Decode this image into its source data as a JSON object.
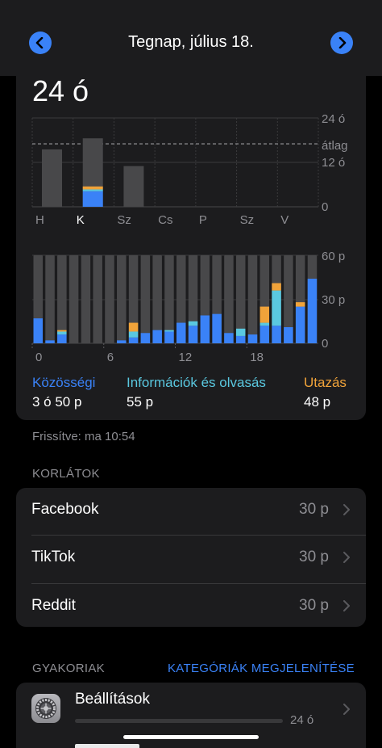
{
  "header": {
    "title": "Tegnap, július 18."
  },
  "summary": {
    "total": "24 ó"
  },
  "weekly_chart": {
    "days": [
      "H",
      "K",
      "Sz",
      "Cs",
      "P",
      "Sz",
      "V"
    ],
    "axis": {
      "top": "24 ó",
      "avg": "átlag",
      "mid": "12 ó",
      "zero": "0"
    },
    "colors": {
      "social": "#3a82f7",
      "info": "#5ac8e0",
      "travel": "#f0a33a",
      "other": "#48484a"
    }
  },
  "chart_data": [
    {
      "type": "bar",
      "categories": [
        "H",
        "K",
        "Sz",
        "Cs",
        "P",
        "Sz",
        "V"
      ],
      "series": [
        {
          "name": "Közösségi",
          "values": [
            0,
            4.2,
            0,
            0,
            0,
            0,
            0
          ]
        },
        {
          "name": "Információk és olvasás",
          "values": [
            0,
            0.5,
            0,
            0,
            0,
            0,
            0
          ]
        },
        {
          "name": "Utazás",
          "values": [
            0,
            0.8,
            0,
            0,
            0,
            0,
            0
          ]
        },
        {
          "values": [
            15.5,
            18.5,
            11,
            0,
            0,
            0,
            0
          ]
        }
      ],
      "ylim": [
        0,
        24
      ],
      "average": 17
    },
    {
      "type": "bar",
      "categories": [
        "0",
        "1",
        "2",
        "3",
        "4",
        "5",
        "6",
        "7",
        "8",
        "9",
        "10",
        "11",
        "12",
        "13",
        "14",
        "15",
        "16",
        "17",
        "18",
        "19",
        "20",
        "21",
        "22",
        "23"
      ],
      "series": [
        {
          "name": "Közösségi",
          "values": [
            17,
            2,
            6,
            0,
            0,
            0,
            0,
            2,
            4,
            7,
            9,
            8,
            14,
            12,
            19,
            20,
            7,
            5,
            6,
            12,
            12,
            11,
            25,
            44
          ]
        },
        {
          "name": "Információk és olvasás",
          "values": [
            0,
            0,
            2,
            0,
            0,
            0,
            0,
            0,
            4,
            0,
            0,
            1,
            0,
            3,
            0,
            0,
            0,
            5,
            0,
            2,
            24,
            0,
            0,
            0
          ]
        },
        {
          "name": "Utazás",
          "values": [
            0,
            0,
            1,
            0,
            0,
            0,
            0,
            0,
            6,
            0,
            0,
            0,
            0,
            0,
            0,
            0,
            0,
            0,
            0,
            11,
            5,
            0,
            3,
            0
          ]
        },
        {
          "values": [
            60,
            60,
            60,
            60,
            60,
            60,
            60,
            60,
            60,
            60,
            60,
            60,
            60,
            60,
            60,
            60,
            60,
            60,
            60,
            60,
            60,
            60,
            60,
            60
          ]
        }
      ],
      "ylim": [
        0,
        60
      ],
      "x_tick_labels": [
        "0",
        "6",
        "12",
        "18"
      ],
      "y_tick_labels": [
        "60 p",
        "30 p",
        "0"
      ]
    }
  ],
  "legend": [
    {
      "name": "Közösségi",
      "value": "3 ó 50 p",
      "color": "#3a82f7"
    },
    {
      "name": "Információk és olvasás",
      "value": "55 p",
      "color": "#5ac8e0"
    },
    {
      "name": "Utazás",
      "value": "48 p",
      "color": "#f0a33a"
    }
  ],
  "updated": "Frissítve: ma 10:54",
  "limits": {
    "title": "KORLÁTOK",
    "items": [
      {
        "name": "Facebook",
        "value": "30 p"
      },
      {
        "name": "TikTok",
        "value": "30 p"
      },
      {
        "name": "Reddit",
        "value": "30 p"
      }
    ]
  },
  "frequent": {
    "title": "GYAKORIAK",
    "link": "KATEGÓRIÁK MEGJELENÍTÉSE",
    "items": [
      {
        "name": "Beállítások",
        "value": "24 ó",
        "icon": "settings-gear-icon"
      }
    ]
  }
}
